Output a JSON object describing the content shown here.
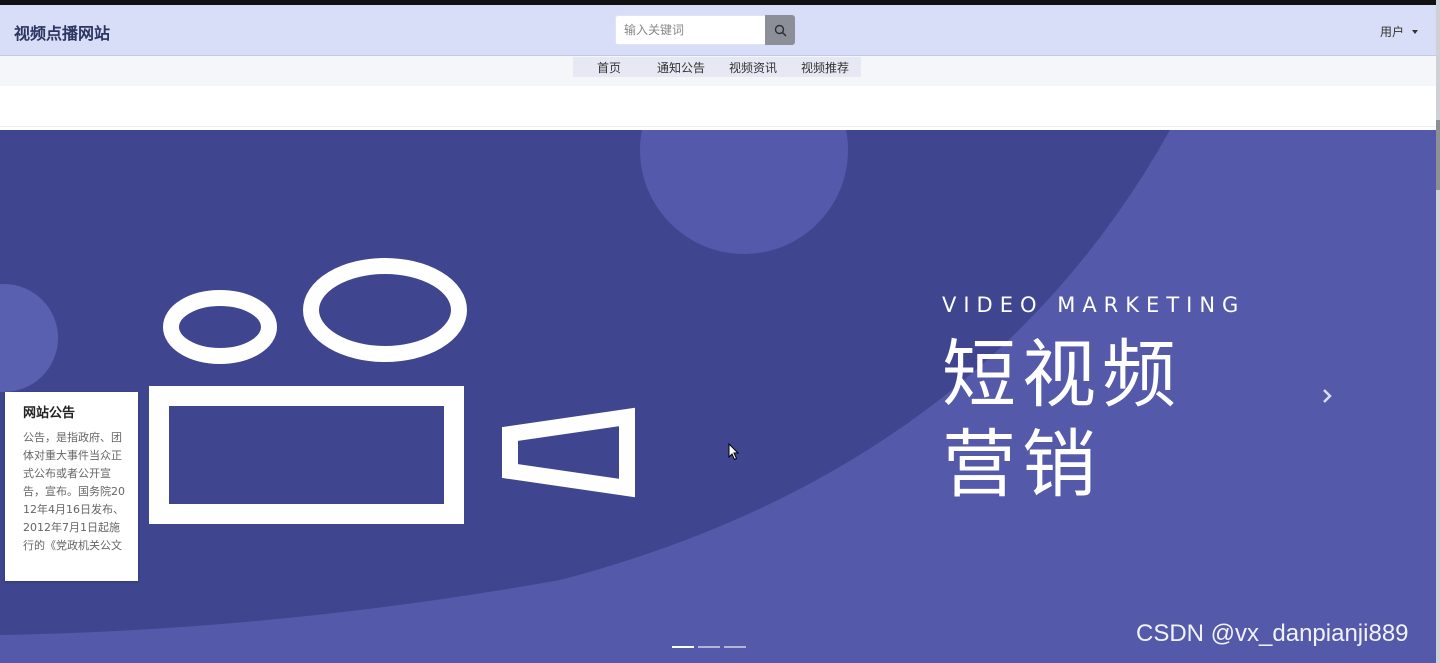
{
  "header": {
    "site_title": "视频点播网站",
    "search": {
      "placeholder": "输入关键词"
    },
    "user_menu": {
      "label": "用户"
    }
  },
  "nav": {
    "items": [
      {
        "label": "首页"
      },
      {
        "label": "通知公告"
      },
      {
        "label": "视频资讯"
      },
      {
        "label": "视频推荐"
      }
    ]
  },
  "banner": {
    "eyebrow": "VIDEO MARKETING",
    "title_line1": "短视频",
    "title_line2": "营销",
    "slide_count": 3,
    "active_slide": 1,
    "colors": {
      "background": "#545aa9",
      "dark_arc": "#3f458f",
      "accent_circles": "#5a60b0"
    }
  },
  "notice_card": {
    "title": "网站公告",
    "body": "公告，是指政府、团体对重大事件当众正式公布或者公开宣告，宣布。国务院2012年4月16日发布、2012年7月1日起施行的《党政机关公文"
  },
  "watermark": "CSDN @vx_danpianji889",
  "icons": {
    "search": "search-icon",
    "caret": "caret-down-icon",
    "next": "chevron-right-icon",
    "cursor": "mouse-cursor-icon"
  }
}
